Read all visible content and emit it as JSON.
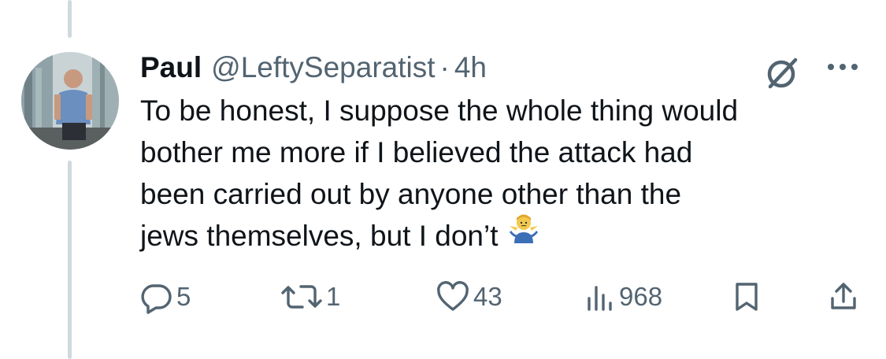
{
  "tweet": {
    "display_name": "Paul",
    "handle": "@LeftySeparatist",
    "separator": "·",
    "time": "4h",
    "text_lines": [
      "To be honest, I suppose the whole thing would",
      "bother me more if I believed the attack had",
      "been carried out by anyone other than the",
      "jews themselves, but I don’t"
    ],
    "emoji": "person-shrugging-emoji"
  },
  "actions": {
    "replies": "5",
    "reposts": "1",
    "likes": "43",
    "views": "968"
  },
  "icons": {
    "grok": "grok-icon",
    "more": "more-icon",
    "reply": "reply-icon",
    "repost": "repost-icon",
    "like": "heart-icon",
    "views": "views-icon",
    "bookmark": "bookmark-icon",
    "share": "share-icon"
  },
  "colors": {
    "text": "#0f1419",
    "secondary": "#536471",
    "thread_line": "#cfd9de"
  }
}
